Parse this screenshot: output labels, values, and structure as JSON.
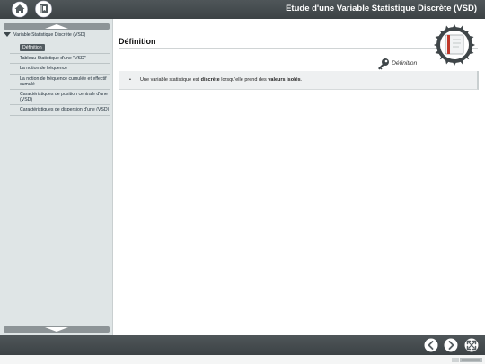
{
  "header": {
    "title": "Etude d'une Variable Statistique Discrète (VSD)",
    "home_icon": "home-icon",
    "book_icon": "book-icon"
  },
  "sidebar": {
    "scroll_up_icon": "chevron-up-icon",
    "scroll_down_icon": "chevron-down-icon",
    "root": {
      "label": "Variable Statistique Discrète (VSD)",
      "expanded": true
    },
    "items": [
      {
        "label": "Définition",
        "selected": true
      },
      {
        "label": "Tableau Statistique d'une \"VSD\""
      },
      {
        "label": "La notion de fréquence"
      },
      {
        "label": "La notion de fréquence cumulée et effectif cumulé"
      },
      {
        "label": "Caractéristiques de position centrale d'une (VSD)"
      },
      {
        "label": "Caractéristiques de dispersion d'une (VSD)"
      }
    ]
  },
  "main": {
    "page_title": "Définition",
    "section_label": "Définition",
    "definition": {
      "bullet": "•",
      "part1": "Une variable statistique est ",
      "bold1": "discrète",
      "part2": " lorsqu'elle prend des ",
      "bold2": "valeurs isolés",
      "part3": "."
    }
  },
  "footer": {
    "prev_icon": "arrow-left-icon",
    "next_icon": "arrow-right-icon",
    "fullscreen_icon": "fullscreen-icon"
  },
  "colors": {
    "bar": "#454b4e",
    "sidebar_bg": "#dfe5e6",
    "selected_bg": "#525b60",
    "definition_bg": "#eef0f1"
  }
}
